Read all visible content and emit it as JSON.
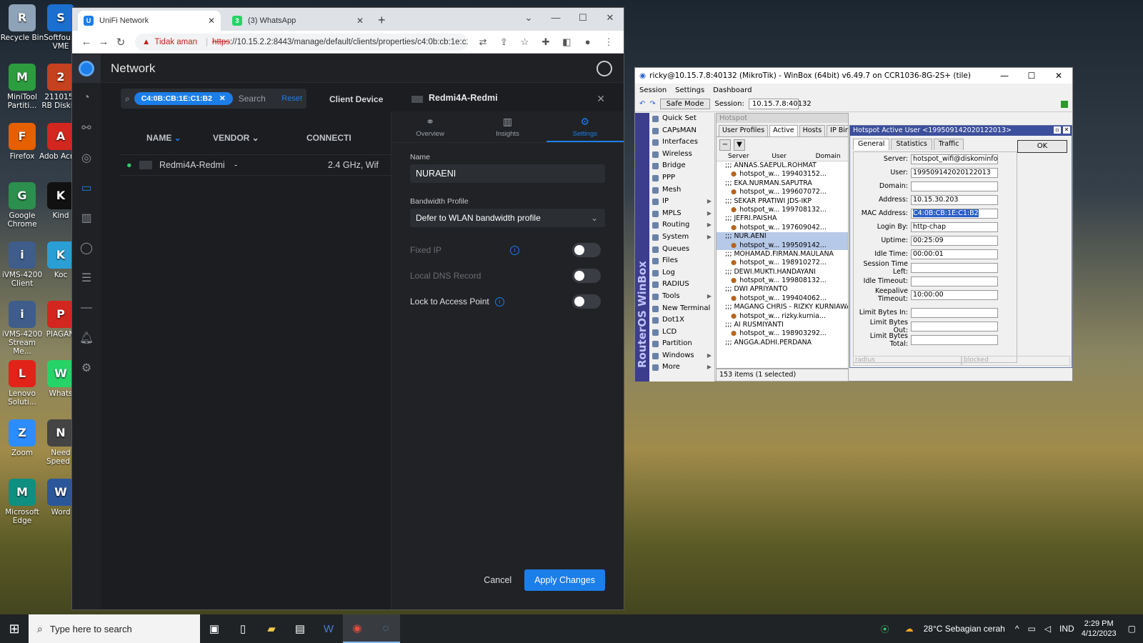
{
  "desktop": {
    "icons": [
      {
        "label": "Recycle Bin",
        "icon": "recycle-bin-icon",
        "color": "#8fa3b8"
      },
      {
        "label": "Softfou... VME",
        "icon": "softfoundry-icon",
        "color": "#1b6fd1"
      },
      {
        "label": "MiniTool Partiti...",
        "icon": "minitool-icon",
        "color": "#2d9c3f"
      },
      {
        "label": "211015_ RB Diski...",
        "icon": "powerpoint-icon",
        "color": "#c6411e"
      },
      {
        "label": "Firefox",
        "icon": "firefox-icon",
        "color": "#e66000"
      },
      {
        "label": "Adob Acrob",
        "icon": "acrobat-icon",
        "color": "#d3261e"
      },
      {
        "label": "Google Chrome",
        "icon": "chrome-icon",
        "color": "#2c8f4d"
      },
      {
        "label": "Kind",
        "icon": "kindle-icon",
        "color": "#111111"
      },
      {
        "label": "iVMS-4200 Client",
        "icon": "ivms-icon",
        "color": "#3f5d8a"
      },
      {
        "label": "Koc",
        "icon": "kodi-icon",
        "color": "#2a9fd6"
      },
      {
        "label": "iVMS-4200 Stream Me...",
        "icon": "ivms-stream-icon",
        "color": "#3f5d8a"
      },
      {
        "label": "PIAGAM",
        "icon": "pdf-icon",
        "color": "#d3261e"
      },
      {
        "label": "Lenovo Soluti...",
        "icon": "lenovo-icon",
        "color": "#e2231a"
      },
      {
        "label": "Whats",
        "icon": "whatsapp-icon",
        "color": "#25d366"
      },
      {
        "label": "Zoom",
        "icon": "zoom-icon",
        "color": "#2d8cff"
      },
      {
        "label": "Need Speed -",
        "icon": "nfs-icon",
        "color": "#444444"
      },
      {
        "label": "Microsoft Edge",
        "icon": "edge-icon",
        "color": "#0f8f7f"
      },
      {
        "label": "Word",
        "icon": "word-icon",
        "color": "#2b579a"
      }
    ]
  },
  "browser": {
    "tabs": [
      {
        "label": "UniFi Network",
        "fav": "U",
        "color": "#1c7ee8",
        "active": true
      },
      {
        "label": "(3) WhatsApp",
        "fav": "3",
        "color": "#25d366",
        "active": false
      }
    ],
    "security_warning": "Tidak aman",
    "url_scheme": "https",
    "url_rest": "://10.15.2.2:8443/manage/default/clients/properties/c4:0b:cb:1e:c1:..."
  },
  "unifi": {
    "app_title": "Network",
    "search": {
      "chip": "C4:0B:CB:1E:C1:B2",
      "placeholder": "Search",
      "reset": "Reset"
    },
    "client_device_label": "Client Device",
    "columns": {
      "name": "NAME",
      "vendor": "VENDOR",
      "connection": "CONNECTI"
    },
    "client_row": {
      "name": "Redmi4A-Redmi",
      "vendor": "-",
      "connection": "2.4 GHz, Wif"
    },
    "panel": {
      "device_title": "Redmi4A-Redmi",
      "tabs": [
        {
          "label": "Overview",
          "icon": "binoculars-icon"
        },
        {
          "label": "Insights",
          "icon": "bar-chart-icon"
        },
        {
          "label": "Settings",
          "icon": "gear-icon"
        }
      ],
      "name_label": "Name",
      "name_value": "NURAENI",
      "bandwidth_label": "Bandwidth Profile",
      "bandwidth_value": "Defer to WLAN bandwidth profile",
      "fixed_ip": "Fixed IP",
      "local_dns": "Local DNS Record",
      "lock_ap": "Lock to Access Point",
      "cancel": "Cancel",
      "apply": "Apply Changes"
    }
  },
  "winbox": {
    "title": "ricky@10.15.7.8:40132 (MikroTik) - WinBox (64bit) v6.49.7 on CCR1036-8G-2S+ (tile)",
    "menu": [
      "Session",
      "Settings",
      "Dashboard"
    ],
    "safe_mode": "Safe Mode",
    "session_label": "Session:",
    "session_value": "10.15.7.8:40132",
    "brand": "RouterOS WinBox",
    "nav": [
      {
        "label": "Quick Set",
        "arrow": false
      },
      {
        "label": "CAPsMAN",
        "arrow": false
      },
      {
        "label": "Interfaces",
        "arrow": false
      },
      {
        "label": "Wireless",
        "arrow": false
      },
      {
        "label": "Bridge",
        "arrow": false
      },
      {
        "label": "PPP",
        "arrow": false
      },
      {
        "label": "Mesh",
        "arrow": false
      },
      {
        "label": "IP",
        "arrow": true
      },
      {
        "label": "MPLS",
        "arrow": true
      },
      {
        "label": "Routing",
        "arrow": true
      },
      {
        "label": "System",
        "arrow": true
      },
      {
        "label": "Queues",
        "arrow": false
      },
      {
        "label": "Files",
        "arrow": false
      },
      {
        "label": "Log",
        "arrow": false
      },
      {
        "label": "RADIUS",
        "arrow": false
      },
      {
        "label": "Tools",
        "arrow": true
      },
      {
        "label": "New Terminal",
        "arrow": false
      },
      {
        "label": "Dot1X",
        "arrow": false
      },
      {
        "label": "LCD",
        "arrow": false
      },
      {
        "label": "Partition",
        "arrow": false
      },
      {
        "label": "Windows",
        "arrow": true
      },
      {
        "label": "More",
        "arrow": true
      }
    ],
    "hotspot": {
      "title": "Hotspot",
      "tabs": [
        "User Profiles",
        "Active",
        "Hosts",
        "IP Bindings"
      ],
      "columns": [
        "Server",
        "User",
        "Domain"
      ],
      "rows": [
        {
          "text": ";;; ANNAS.SAEPUL.ROHMAT",
          "type": "comment"
        },
        {
          "text": "hotspot_w...  199403152...",
          "type": "user"
        },
        {
          "text": ";;; EKA.NURMAN.SAPUTRA",
          "type": "comment"
        },
        {
          "text": "hotspot_w...  199607072...",
          "type": "user"
        },
        {
          "text": ";;; SEKAR PRATIWI JDS-IKP",
          "type": "comment"
        },
        {
          "text": "hotspot_w...  199708132...",
          "type": "user"
        },
        {
          "text": ";;; JEFRI.PAISHA",
          "type": "comment"
        },
        {
          "text": "hotspot_w...  197609042...",
          "type": "user"
        },
        {
          "text": ";;; NUR.AENI",
          "type": "comment sel"
        },
        {
          "text": "hotspot_w...  199509142...",
          "type": "user sel"
        },
        {
          "text": ";;; MOHAMAD.FIRMAN.MAULANA",
          "type": "comment"
        },
        {
          "text": "hotspot_w...  198910272...",
          "type": "user"
        },
        {
          "text": ";;; DEWI.MUKTI.HANDAYANI",
          "type": "comment"
        },
        {
          "text": "hotspot_w...  199808132...",
          "type": "user"
        },
        {
          "text": ";;; DWI APRIYANTO",
          "type": "comment"
        },
        {
          "text": "hotspot_w...  199404062...",
          "type": "user"
        },
        {
          "text": ";;; MAGANG CHRIS - RIZKY KURNIAWAN",
          "type": "comment"
        },
        {
          "text": "hotspot_w...  rizky.kurnia...",
          "type": "user"
        },
        {
          "text": ";;; AI RUSMIYANTI",
          "type": "comment"
        },
        {
          "text": "hotspot_w...  198903292...",
          "type": "user"
        },
        {
          "text": ";;; ANGGA.ADHI.PERDANA",
          "type": "comment"
        }
      ],
      "status": "153 items (1 selected)"
    },
    "dialog": {
      "title": "Hotspot Active User <199509142020122013>",
      "tabs": [
        "General",
        "Statistics",
        "Traffic"
      ],
      "ok": "OK",
      "fields": [
        {
          "label": "Server:",
          "value": "hotspot_wifi@diskominfo"
        },
        {
          "label": "User:",
          "value": "199509142020122013"
        },
        {
          "label": "Domain:",
          "value": ""
        },
        {
          "label": "Address:",
          "value": "10.15.30.203"
        },
        {
          "label": "MAC Address:",
          "value": "C4:0B:CB:1E:C1:B2",
          "highlight": true
        },
        {
          "label": "Login By:",
          "value": "http-chap"
        },
        {
          "label": "Uptime:",
          "value": "00:25:09"
        },
        {
          "label": "Idle Time:",
          "value": "00:00:01"
        },
        {
          "label": "Session Time Left:",
          "value": ""
        },
        {
          "label": "Idle Timeout:",
          "value": ""
        },
        {
          "label": "Keepalive Timeout:",
          "value": "10:00:00"
        },
        {
          "label": "Limit Bytes In:",
          "value": ""
        },
        {
          "label": "Limit Bytes Out:",
          "value": ""
        },
        {
          "label": "Limit Bytes Total:",
          "value": ""
        }
      ],
      "status_left": "radius",
      "status_right": "blocked"
    }
  },
  "taskbar": {
    "search_placeholder": "Type here to search",
    "weather": "28°C  Sebagian cerah",
    "lang": "IND",
    "time": "2:29 PM",
    "date": "4/12/2023"
  }
}
